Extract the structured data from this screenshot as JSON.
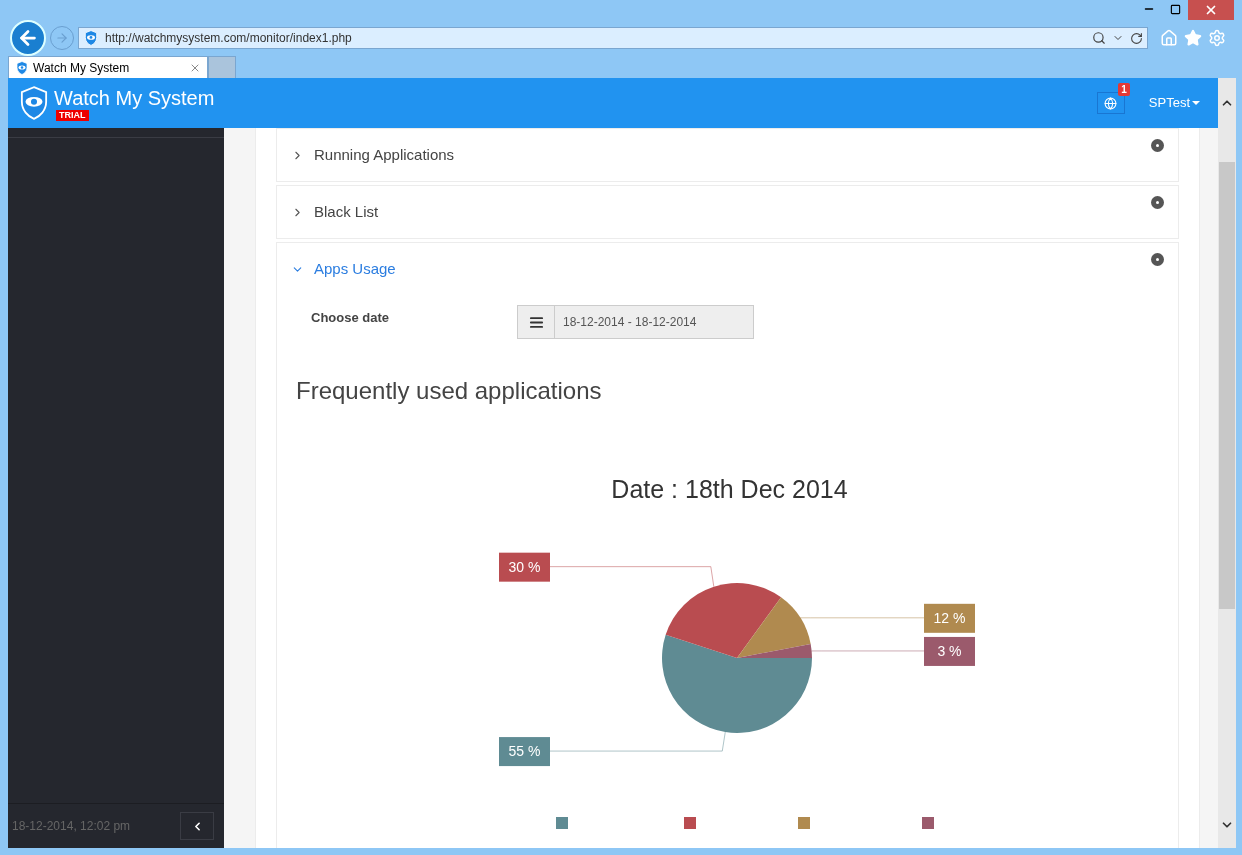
{
  "browser": {
    "address": "http://watchmysystem.com/monitor/index1.php",
    "tabs": [
      {
        "label": "Watch My System",
        "selected": true
      }
    ]
  },
  "header": {
    "brand": "Watch My System",
    "badge": "TRIAL",
    "notification_count": "1",
    "user": "SPTest"
  },
  "sidebar": {
    "footer_time": "18-12-2014, 12:02 pm"
  },
  "accordion": [
    {
      "title": "Running Applications",
      "expanded": false
    },
    {
      "title": "Black List",
      "expanded": false
    },
    {
      "title": "Apps Usage",
      "expanded": true
    }
  ],
  "filter": {
    "label": "Choose date",
    "value": "18-12-2014 - 18-12-2014"
  },
  "section_title": "Frequently used applications",
  "chart_data": {
    "type": "pie",
    "title": "Date : 18th Dec 2014",
    "values": [
      55,
      30,
      12,
      3
    ],
    "colors": [
      "#5f8b93",
      "#b94c50",
      "#b08a4f",
      "#9b5a6c"
    ],
    "value_labels": [
      "55 %",
      "30 %",
      "12 %",
      "3 %"
    ]
  }
}
